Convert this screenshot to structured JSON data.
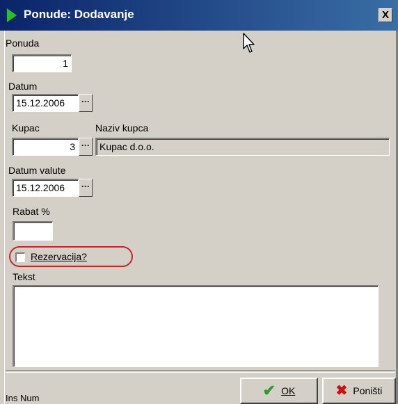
{
  "window": {
    "title": "Ponude: Dodavanje",
    "close_label": "X"
  },
  "fields": {
    "ponuda": {
      "label": "Ponuda",
      "value": "1"
    },
    "datum": {
      "label": "Datum",
      "value": "15.12.2006",
      "button_label": "···"
    },
    "kupac": {
      "label": "Kupac",
      "value": "3",
      "button_label": "···"
    },
    "naziv_kupca": {
      "label": "Naziv kupca",
      "value": "Kupac d.o.o."
    },
    "datum_valute": {
      "label": "Datum valute",
      "value": "15.12.2006",
      "button_label": "···"
    },
    "rabat": {
      "label": "Rabat %",
      "value": ""
    },
    "rezervacija": {
      "label": "Rezervacija?",
      "checked": false
    },
    "tekst": {
      "label": "Tekst",
      "value": ""
    }
  },
  "buttons": {
    "ok_label": "OK",
    "cancel_label": "Poništi",
    "ok_icon": "checkmark-icon",
    "cancel_icon": "x-icon"
  },
  "status": {
    "left_text": "Ins Num"
  },
  "colors": {
    "title_gradient_start": "#0a246a",
    "title_gradient_end": "#3a6ea5",
    "window_bg": "#d4d0c8",
    "highlight_ring": "#c0272d",
    "ok_icon_color": "#2e9a2e",
    "cancel_icon_color": "#cc1111"
  }
}
